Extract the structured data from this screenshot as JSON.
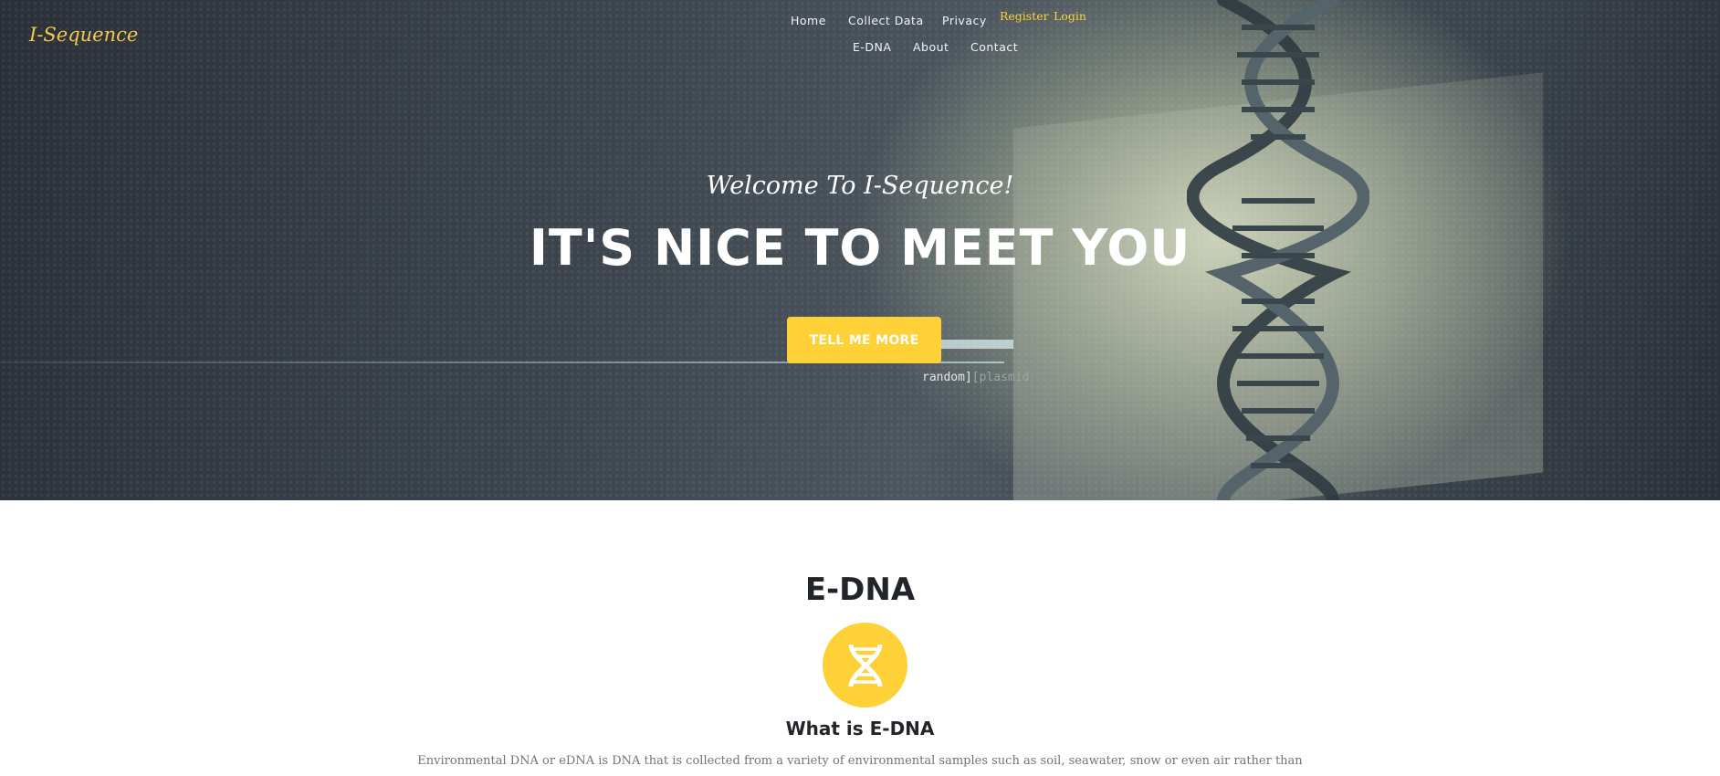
{
  "brand": {
    "logo": "I-Sequence"
  },
  "nav": {
    "items": [
      "Home",
      "Collect Data",
      "Privacy",
      "E-DNA",
      "About",
      "Contact"
    ],
    "register": "Register",
    "login": "Login"
  },
  "hero": {
    "subheading": "Welcome To I-Sequence!",
    "heading": "IT'S NICE TO MEET YOU",
    "cta": "TELL ME MORE",
    "bg_text_a": "random]",
    "bg_text_b": "[plasmid"
  },
  "section": {
    "title": "E-DNA",
    "icon": "dna-icon",
    "subtitle": "What is E-DNA",
    "text": "Environmental DNA or eDNA is DNA that is collected from a variety of environmental samples such as soil, seawater, snow or even air rather than"
  },
  "colors": {
    "accent": "#fed136",
    "heading": "#212529",
    "muted": "#6c757d"
  }
}
